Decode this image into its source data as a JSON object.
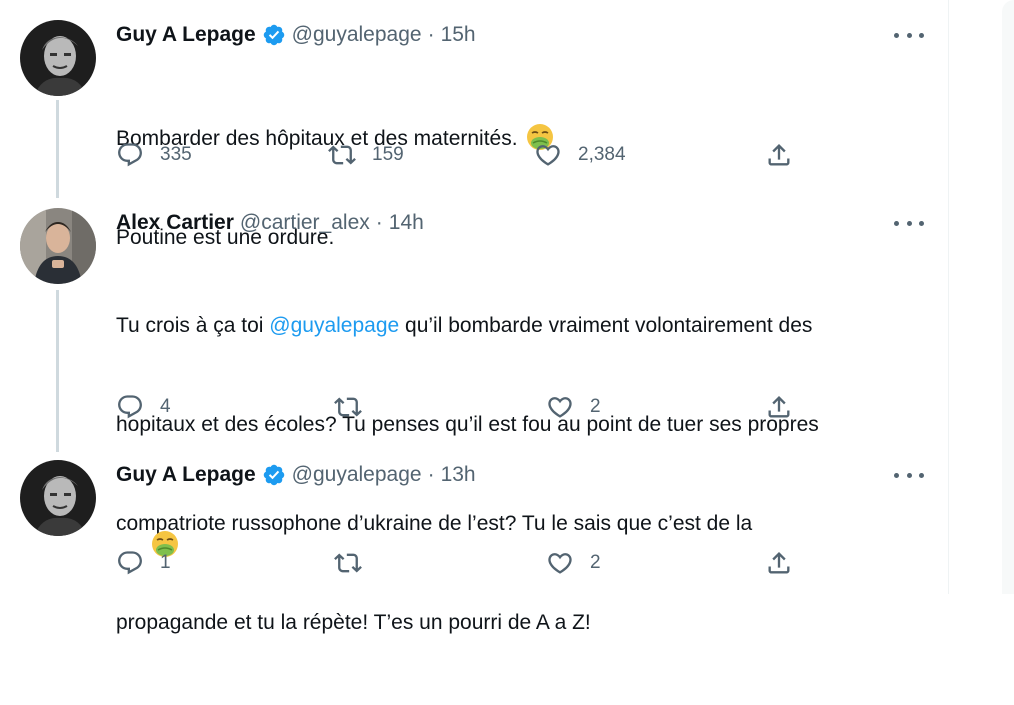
{
  "tweets": [
    {
      "name": "Guy A Lepage",
      "handle": "@guyalepage",
      "separator": "·",
      "time": "15h",
      "line1": "Bombarder des hôpitaux et des maternités.",
      "line2": "Poutine est une ordure.",
      "emoji_icon": "nauseated-face-icon",
      "replies": "335",
      "retweets": "159",
      "likes": "2,384",
      "verified": true
    },
    {
      "name": "Alex Cartier",
      "handle": "@cartier_alex",
      "separator": "·",
      "time": "14h",
      "text_before_mention": "Tu crois à ça toi ",
      "mention": "@guyalepage",
      "text_after_mention": " qu’il bombarde vraiment volontairement des",
      "line2": "hopitaux et des écoles? Tu penses qu’il est fou au point de tuer ses propres",
      "line3": "compatriote russophone d’ukraine de l’est? Tu le sais que c’est de la",
      "line4": "propagande et tu la répète! T’es un pourri de A a Z!",
      "replies": "4",
      "retweets": "",
      "likes": "2",
      "verified": false
    },
    {
      "name": "Guy A Lepage",
      "handle": "@guyalepage",
      "separator": "·",
      "time": "13h",
      "emoji_icon": "nauseated-face-icon",
      "replies": "1",
      "retweets": "",
      "likes": "2",
      "verified": true
    }
  ],
  "colors": {
    "text": "#0f1419",
    "secondary": "#536471",
    "link": "#1d9bf0",
    "verified": "#1d9bf0",
    "thread_line": "#cfd9de"
  }
}
